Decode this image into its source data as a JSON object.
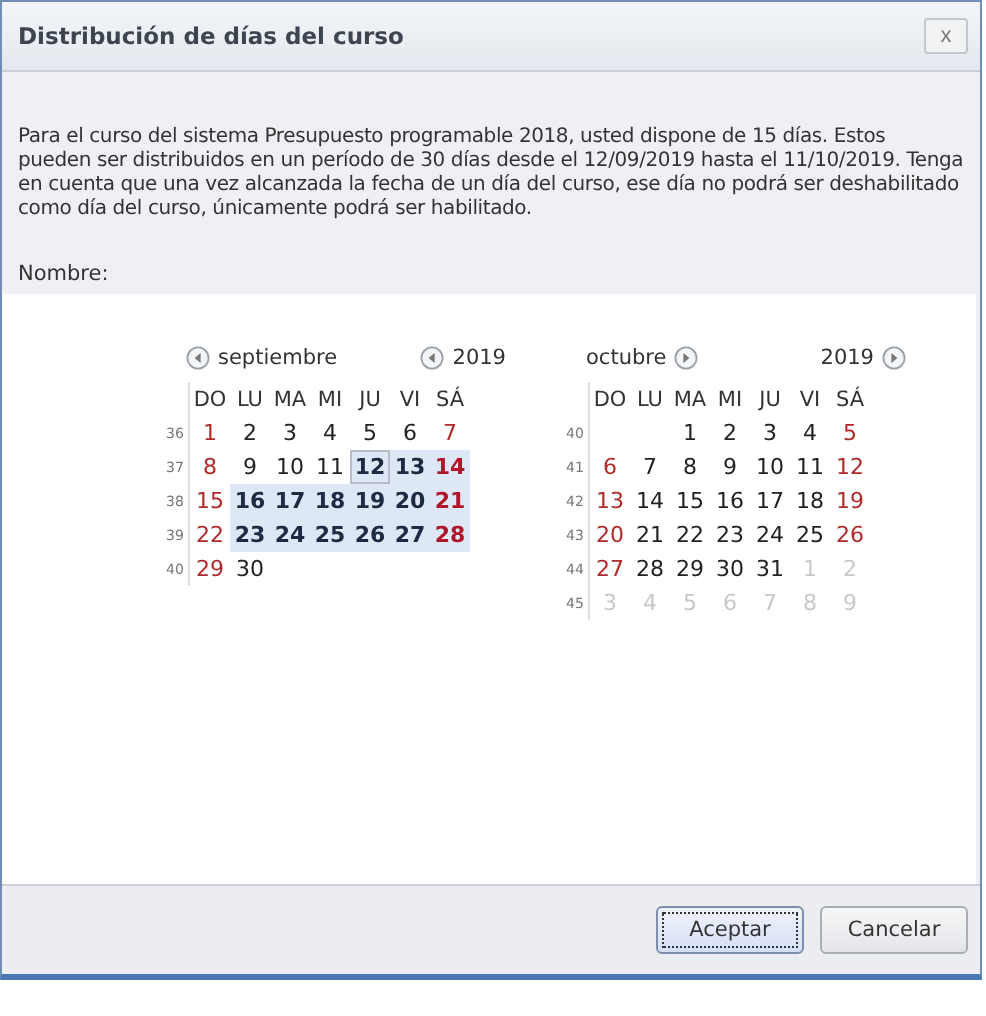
{
  "window": {
    "title": "Distribución de días del curso",
    "close": "x"
  },
  "message": "Para el curso del sistema Presupuesto programable 2018, usted dispone de 15 días. Estos pueden ser distribuidos en un período de 30 días desde el 12/09/2019 hasta el 11/10/2019. Tenga en cuenta que una vez alcanzada la fecha de un día del curso, ese día no podrá ser deshabilitado como día del curso, únicamente podrá ser habilitado.",
  "name_label": "Nombre:",
  "calendars": [
    {
      "month": "septiembre",
      "year": "2019",
      "kind": "first",
      "weekdays": [
        "DO",
        "LU",
        "MA",
        "MI",
        "JU",
        "VI",
        "SÁ"
      ],
      "weeks": [
        {
          "number": "36",
          "days": [
            {
              "d": "1",
              "kind": "weekend",
              "selected": false,
              "today": false
            },
            {
              "d": "2",
              "kind": "weekday",
              "selected": false,
              "today": false
            },
            {
              "d": "3",
              "kind": "weekday",
              "selected": false,
              "today": false
            },
            {
              "d": "4",
              "kind": "weekday",
              "selected": false,
              "today": false
            },
            {
              "d": "5",
              "kind": "weekday",
              "selected": false,
              "today": false
            },
            {
              "d": "6",
              "kind": "weekday",
              "selected": false,
              "today": false
            },
            {
              "d": "7",
              "kind": "weekend",
              "selected": false,
              "today": false
            }
          ]
        },
        {
          "number": "37",
          "days": [
            {
              "d": "8",
              "kind": "weekend",
              "selected": false,
              "today": false
            },
            {
              "d": "9",
              "kind": "weekday",
              "selected": false,
              "today": false
            },
            {
              "d": "10",
              "kind": "weekday",
              "selected": false,
              "today": false
            },
            {
              "d": "11",
              "kind": "weekday",
              "selected": false,
              "today": false
            },
            {
              "d": "12",
              "kind": "weekday",
              "selected": true,
              "today": true
            },
            {
              "d": "13",
              "kind": "weekday",
              "selected": true,
              "today": false
            },
            {
              "d": "14",
              "kind": "weekend",
              "selected": true,
              "today": false
            }
          ]
        },
        {
          "number": "38",
          "days": [
            {
              "d": "15",
              "kind": "weekend",
              "selected": false,
              "today": false
            },
            {
              "d": "16",
              "kind": "weekday",
              "selected": true,
              "today": false
            },
            {
              "d": "17",
              "kind": "weekday",
              "selected": true,
              "today": false
            },
            {
              "d": "18",
              "kind": "weekday",
              "selected": true,
              "today": false
            },
            {
              "d": "19",
              "kind": "weekday",
              "selected": true,
              "today": false
            },
            {
              "d": "20",
              "kind": "weekday",
              "selected": true,
              "today": false
            },
            {
              "d": "21",
              "kind": "weekend",
              "selected": true,
              "today": false
            }
          ]
        },
        {
          "number": "39",
          "days": [
            {
              "d": "22",
              "kind": "weekend",
              "selected": false,
              "today": false
            },
            {
              "d": "23",
              "kind": "weekday",
              "selected": true,
              "today": false
            },
            {
              "d": "24",
              "kind": "weekday",
              "selected": true,
              "today": false
            },
            {
              "d": "25",
              "kind": "weekday",
              "selected": true,
              "today": false
            },
            {
              "d": "26",
              "kind": "weekday",
              "selected": true,
              "today": false
            },
            {
              "d": "27",
              "kind": "weekday",
              "selected": true,
              "today": false
            },
            {
              "d": "28",
              "kind": "weekend",
              "selected": true,
              "today": false
            }
          ]
        },
        {
          "number": "40",
          "days": [
            {
              "d": "29",
              "kind": "weekend",
              "selected": false,
              "today": false
            },
            {
              "d": "30",
              "kind": "weekday",
              "selected": false,
              "today": false
            }
          ]
        }
      ]
    },
    {
      "month": "octubre",
      "year": "2019",
      "kind": "last",
      "weekdays": [
        "DO",
        "LU",
        "MA",
        "MI",
        "JU",
        "VI",
        "SÁ"
      ],
      "weeks": [
        {
          "number": "40",
          "days": [
            {
              "kind": "blank"
            },
            {
              "kind": "blank"
            },
            {
              "d": "1",
              "kind": "weekday",
              "selected": false,
              "today": false
            },
            {
              "d": "2",
              "kind": "weekday",
              "selected": false,
              "today": false
            },
            {
              "d": "3",
              "kind": "weekday",
              "selected": false,
              "today": false
            },
            {
              "d": "4",
              "kind": "weekday",
              "selected": false,
              "today": false
            },
            {
              "d": "5",
              "kind": "weekend",
              "selected": false,
              "today": false
            }
          ]
        },
        {
          "number": "41",
          "days": [
            {
              "d": "6",
              "kind": "weekend",
              "selected": false,
              "today": false
            },
            {
              "d": "7",
              "kind": "weekday",
              "selected": false,
              "today": false
            },
            {
              "d": "8",
              "kind": "weekday",
              "selected": false,
              "today": false
            },
            {
              "d": "9",
              "kind": "weekday",
              "selected": false,
              "today": false
            },
            {
              "d": "10",
              "kind": "weekday",
              "selected": false,
              "today": false
            },
            {
              "d": "11",
              "kind": "weekday",
              "selected": false,
              "today": false
            },
            {
              "d": "12",
              "kind": "weekend",
              "selected": false,
              "today": false
            }
          ]
        },
        {
          "number": "42",
          "days": [
            {
              "d": "13",
              "kind": "weekend",
              "selected": false,
              "today": false
            },
            {
              "d": "14",
              "kind": "weekday",
              "selected": false,
              "today": false
            },
            {
              "d": "15",
              "kind": "weekday",
              "selected": false,
              "today": false
            },
            {
              "d": "16",
              "kind": "weekday",
              "selected": false,
              "today": false
            },
            {
              "d": "17",
              "kind": "weekday",
              "selected": false,
              "today": false
            },
            {
              "d": "18",
              "kind": "weekday",
              "selected": false,
              "today": false
            },
            {
              "d": "19",
              "kind": "weekend",
              "selected": false,
              "today": false
            }
          ]
        },
        {
          "number": "43",
          "days": [
            {
              "d": "20",
              "kind": "weekend",
              "selected": false,
              "today": false
            },
            {
              "d": "21",
              "kind": "weekday",
              "selected": false,
              "today": false
            },
            {
              "d": "22",
              "kind": "weekday",
              "selected": false,
              "today": false
            },
            {
              "d": "23",
              "kind": "weekday",
              "selected": false,
              "today": false
            },
            {
              "d": "24",
              "kind": "weekday",
              "selected": false,
              "today": false
            },
            {
              "d": "25",
              "kind": "weekday",
              "selected": false,
              "today": false
            },
            {
              "d": "26",
              "kind": "weekend",
              "selected": false,
              "today": false
            }
          ]
        },
        {
          "number": "44",
          "days": [
            {
              "d": "27",
              "kind": "weekend",
              "selected": false,
              "today": false
            },
            {
              "d": "28",
              "kind": "weekday",
              "selected": false,
              "today": false
            },
            {
              "d": "29",
              "kind": "weekday",
              "selected": false,
              "today": false
            },
            {
              "d": "30",
              "kind": "weekday",
              "selected": false,
              "today": false
            },
            {
              "d": "31",
              "kind": "weekday",
              "selected": false,
              "today": false
            },
            {
              "d": "1",
              "kind": "other",
              "selected": false,
              "today": false
            },
            {
              "d": "2",
              "kind": "other",
              "selected": false,
              "today": false
            }
          ]
        },
        {
          "number": "45",
          "days": [
            {
              "d": "3",
              "kind": "other",
              "selected": false,
              "today": false
            },
            {
              "d": "4",
              "kind": "other",
              "selected": false,
              "today": false
            },
            {
              "d": "5",
              "kind": "other",
              "selected": false,
              "today": false
            },
            {
              "d": "6",
              "kind": "other",
              "selected": false,
              "today": false
            },
            {
              "d": "7",
              "kind": "other",
              "selected": false,
              "today": false
            },
            {
              "d": "8",
              "kind": "other",
              "selected": false,
              "today": false
            },
            {
              "d": "9",
              "kind": "other",
              "selected": false,
              "today": false
            }
          ]
        }
      ]
    }
  ],
  "buttons": [
    {
      "label": "Aceptar",
      "default": true
    },
    {
      "label": "Cancelar",
      "default": false
    }
  ]
}
